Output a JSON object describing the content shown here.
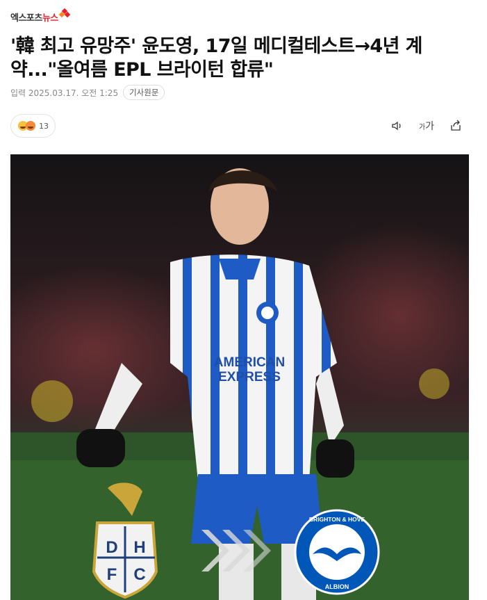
{
  "publisher": {
    "logo_text_1": "엑스포츠",
    "logo_text_2": "뉴스"
  },
  "article": {
    "headline": "'韓 최고 유망주' 윤도영, 17일 메디컬테스트→4년 계약...\"올여름 EPL 브라이턴 합류\"",
    "published": "입력 2025.03.17. 오전 1:25",
    "source_button": "기사원문"
  },
  "reactions": {
    "count": "13"
  },
  "toolbar": {
    "fontsize_label_small": "가",
    "fontsize_label_big": "가"
  },
  "photo": {
    "sponsor_line1": "AMERICAN",
    "sponsor_line2": "EXPRESS",
    "crest_left_letters": [
      "D",
      "H",
      "F",
      "C"
    ],
    "crest_right_top": "BRIGHTON & HOVE",
    "crest_right_bottom": "ALBION"
  },
  "colors": {
    "brand_red": "#e8202a",
    "brighton_blue": "#0057b8"
  }
}
